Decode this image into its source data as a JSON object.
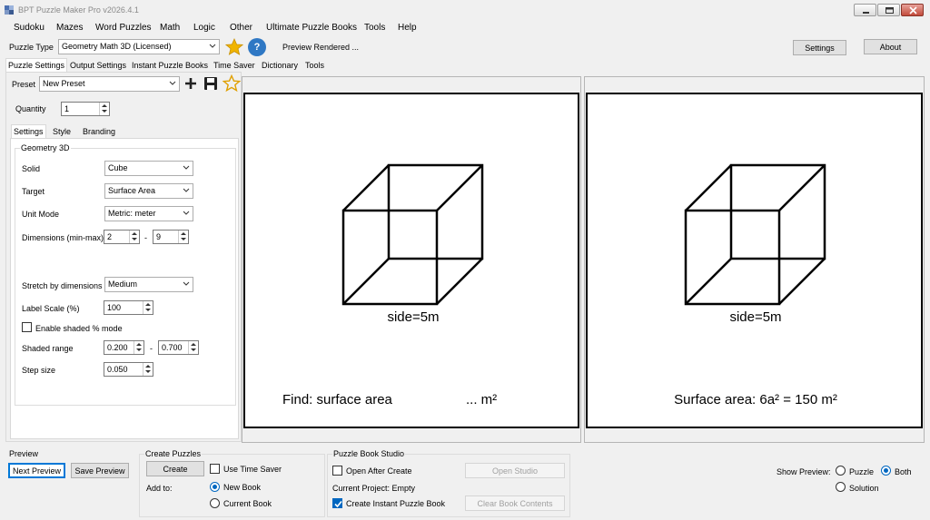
{
  "window": {
    "title": "BPT Puzzle Maker Pro v2026.4.1"
  },
  "menu": [
    "Sudoku",
    "Mazes",
    "Word Puzzles",
    "Math",
    "Logic",
    "Other",
    "Ultimate Puzzle Books",
    "Tools",
    "Help"
  ],
  "toolbar": {
    "puzzle_type_label": "Puzzle Type",
    "puzzle_type_value": "Geometry Math 3D (Licensed)",
    "help_glyph": "?",
    "status": "Preview Rendered ...",
    "settings_button": "Settings",
    "about_button": "About"
  },
  "main_tabs": [
    "Puzzle Settings",
    "Output Settings",
    "Instant Puzzle Books",
    "Time Saver",
    "Dictionary",
    "Tools"
  ],
  "preset": {
    "label": "Preset",
    "value": "New Preset"
  },
  "quantity": {
    "label": "Quantity",
    "value": "1"
  },
  "sub_tabs": [
    "Settings",
    "Style",
    "Branding"
  ],
  "group_title": "Geometry 3D",
  "fields": {
    "solid": {
      "label": "Solid",
      "value": "Cube"
    },
    "target": {
      "label": "Target",
      "value": "Surface Area"
    },
    "unit_mode": {
      "label": "Unit Mode",
      "value": "Metric: meter"
    },
    "dimensions": {
      "label": "Dimensions (min-max)",
      "min": "2",
      "sep": "-",
      "max": "9"
    },
    "stretch": {
      "label": "Stretch by dimensions",
      "value": "Medium"
    },
    "label_scale": {
      "label": "Label Scale (%)",
      "value": "100"
    },
    "shaded_mode": {
      "label": "Enable shaded % mode",
      "checked": false
    },
    "shaded_range": {
      "label": "Shaded range",
      "min": "0.200",
      "sep": "-",
      "max": "0.700"
    },
    "step_size": {
      "label": "Step size",
      "value": "0.050"
    }
  },
  "preview_puzzle": {
    "side_label": "side=5m",
    "find_text": "Find: surface area",
    "answer_blank": "... m²"
  },
  "preview_solution": {
    "side_label": "side=5m",
    "answer_text": "Surface area: 6a² = 150 m²"
  },
  "bottom": {
    "preview": {
      "title": "Preview",
      "next": "Next Preview",
      "save": "Save Preview"
    },
    "create": {
      "title": "Create Puzzles",
      "create_button": "Create",
      "use_time_saver": "Use Time Saver",
      "add_to": "Add to:",
      "new_book": "New Book",
      "current_book": "Current Book"
    },
    "studio": {
      "title": "Puzzle Book Studio",
      "open_after_create": "Open After Create",
      "open_studio": "Open Studio",
      "current_project": "Current Project: Empty",
      "create_instant": "Create Instant Puzzle Book",
      "clear_book": "Clear Book Contents"
    },
    "show_preview": {
      "label": "Show Preview:",
      "puzzle": "Puzzle",
      "both": "Both",
      "solution": "Solution"
    }
  },
  "colors": {
    "accent": "#0067c0",
    "star": "#f0b400",
    "help": "#2f78c4"
  }
}
